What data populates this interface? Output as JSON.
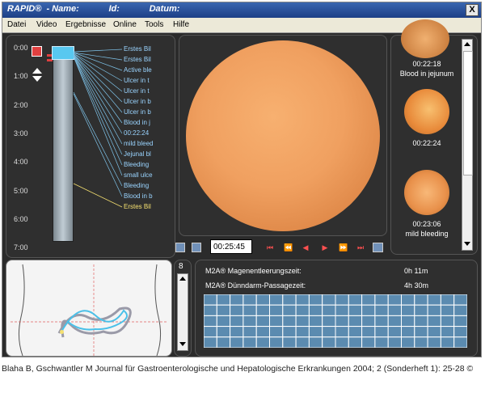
{
  "window": {
    "title": "RAPID®  - Name:            Id:            Datum:",
    "close_label": "X"
  },
  "menu": [
    "Datei",
    "Video",
    "Ergebnisse",
    "Online",
    "Tools",
    "Hilfe"
  ],
  "timeline": {
    "times": [
      "0:00",
      "1:00",
      "2:00",
      "3:00",
      "4:00",
      "5:00",
      "6:00",
      "7:00"
    ],
    "events": [
      "Erstes Bil",
      "Erstes Bil",
      "Active ble",
      "Ulcer in t",
      "Ulcer in t",
      "Ulcer in b",
      "Ulcer in b",
      "Blood in j",
      "00:22:24",
      "mild bleed",
      "Jejunal bl",
      "Bleeding",
      "small ulce",
      "Bleeding",
      "Blood in b",
      "Erstes Bil"
    ]
  },
  "controls": {
    "timecode": "00:25:45"
  },
  "thumbnails": [
    {
      "time": "00:22:18",
      "label": "Blood in jejunum"
    },
    {
      "time": "00:22:24",
      "label": ""
    },
    {
      "time": "00:23:06",
      "label": "mild bleeding"
    }
  ],
  "small_panel": {
    "number": "8"
  },
  "results": [
    {
      "label": "M2A® Magenentleerungszeit:",
      "value": "0h 11m"
    },
    {
      "label": "M2A® Dünndarm-Passagezeit:",
      "value": "4h 30m"
    }
  ],
  "caption": "Blaha B, Gschwantler M Journal für Gastroenterologische und Hepatologische Erkrankungen 2004; 2 (Sonderheft 1): 25-28 ©",
  "colors": {
    "titlebar": "#1d3f86",
    "event_text": "#9ad4ff",
    "last_event": "#f5e070",
    "grid": "#5b8bb0",
    "video": "#f0a060"
  }
}
